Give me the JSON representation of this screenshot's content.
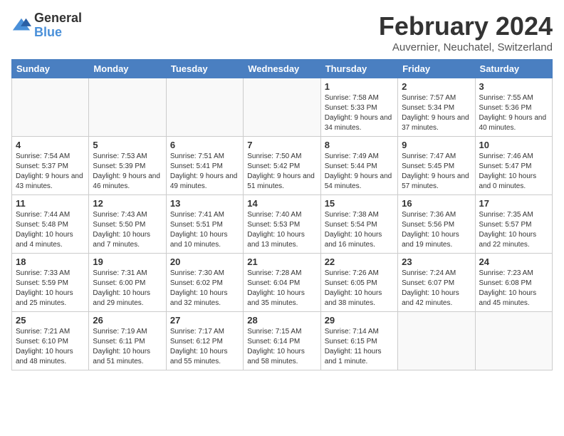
{
  "header": {
    "logo_general": "General",
    "logo_blue": "Blue",
    "title": "February 2024",
    "subtitle": "Auvernier, Neuchatel, Switzerland"
  },
  "days_of_week": [
    "Sunday",
    "Monday",
    "Tuesday",
    "Wednesday",
    "Thursday",
    "Friday",
    "Saturday"
  ],
  "weeks": [
    [
      {
        "num": "",
        "info": ""
      },
      {
        "num": "",
        "info": ""
      },
      {
        "num": "",
        "info": ""
      },
      {
        "num": "",
        "info": ""
      },
      {
        "num": "1",
        "info": "Sunrise: 7:58 AM\nSunset: 5:33 PM\nDaylight: 9 hours\nand 34 minutes."
      },
      {
        "num": "2",
        "info": "Sunrise: 7:57 AM\nSunset: 5:34 PM\nDaylight: 9 hours\nand 37 minutes."
      },
      {
        "num": "3",
        "info": "Sunrise: 7:55 AM\nSunset: 5:36 PM\nDaylight: 9 hours\nand 40 minutes."
      }
    ],
    [
      {
        "num": "4",
        "info": "Sunrise: 7:54 AM\nSunset: 5:37 PM\nDaylight: 9 hours\nand 43 minutes."
      },
      {
        "num": "5",
        "info": "Sunrise: 7:53 AM\nSunset: 5:39 PM\nDaylight: 9 hours\nand 46 minutes."
      },
      {
        "num": "6",
        "info": "Sunrise: 7:51 AM\nSunset: 5:41 PM\nDaylight: 9 hours\nand 49 minutes."
      },
      {
        "num": "7",
        "info": "Sunrise: 7:50 AM\nSunset: 5:42 PM\nDaylight: 9 hours\nand 51 minutes."
      },
      {
        "num": "8",
        "info": "Sunrise: 7:49 AM\nSunset: 5:44 PM\nDaylight: 9 hours\nand 54 minutes."
      },
      {
        "num": "9",
        "info": "Sunrise: 7:47 AM\nSunset: 5:45 PM\nDaylight: 9 hours\nand 57 minutes."
      },
      {
        "num": "10",
        "info": "Sunrise: 7:46 AM\nSunset: 5:47 PM\nDaylight: 10 hours\nand 0 minutes."
      }
    ],
    [
      {
        "num": "11",
        "info": "Sunrise: 7:44 AM\nSunset: 5:48 PM\nDaylight: 10 hours\nand 4 minutes."
      },
      {
        "num": "12",
        "info": "Sunrise: 7:43 AM\nSunset: 5:50 PM\nDaylight: 10 hours\nand 7 minutes."
      },
      {
        "num": "13",
        "info": "Sunrise: 7:41 AM\nSunset: 5:51 PM\nDaylight: 10 hours\nand 10 minutes."
      },
      {
        "num": "14",
        "info": "Sunrise: 7:40 AM\nSunset: 5:53 PM\nDaylight: 10 hours\nand 13 minutes."
      },
      {
        "num": "15",
        "info": "Sunrise: 7:38 AM\nSunset: 5:54 PM\nDaylight: 10 hours\nand 16 minutes."
      },
      {
        "num": "16",
        "info": "Sunrise: 7:36 AM\nSunset: 5:56 PM\nDaylight: 10 hours\nand 19 minutes."
      },
      {
        "num": "17",
        "info": "Sunrise: 7:35 AM\nSunset: 5:57 PM\nDaylight: 10 hours\nand 22 minutes."
      }
    ],
    [
      {
        "num": "18",
        "info": "Sunrise: 7:33 AM\nSunset: 5:59 PM\nDaylight: 10 hours\nand 25 minutes."
      },
      {
        "num": "19",
        "info": "Sunrise: 7:31 AM\nSunset: 6:00 PM\nDaylight: 10 hours\nand 29 minutes."
      },
      {
        "num": "20",
        "info": "Sunrise: 7:30 AM\nSunset: 6:02 PM\nDaylight: 10 hours\nand 32 minutes."
      },
      {
        "num": "21",
        "info": "Sunrise: 7:28 AM\nSunset: 6:04 PM\nDaylight: 10 hours\nand 35 minutes."
      },
      {
        "num": "22",
        "info": "Sunrise: 7:26 AM\nSunset: 6:05 PM\nDaylight: 10 hours\nand 38 minutes."
      },
      {
        "num": "23",
        "info": "Sunrise: 7:24 AM\nSunset: 6:07 PM\nDaylight: 10 hours\nand 42 minutes."
      },
      {
        "num": "24",
        "info": "Sunrise: 7:23 AM\nSunset: 6:08 PM\nDaylight: 10 hours\nand 45 minutes."
      }
    ],
    [
      {
        "num": "25",
        "info": "Sunrise: 7:21 AM\nSunset: 6:10 PM\nDaylight: 10 hours\nand 48 minutes."
      },
      {
        "num": "26",
        "info": "Sunrise: 7:19 AM\nSunset: 6:11 PM\nDaylight: 10 hours\nand 51 minutes."
      },
      {
        "num": "27",
        "info": "Sunrise: 7:17 AM\nSunset: 6:12 PM\nDaylight: 10 hours\nand 55 minutes."
      },
      {
        "num": "28",
        "info": "Sunrise: 7:15 AM\nSunset: 6:14 PM\nDaylight: 10 hours\nand 58 minutes."
      },
      {
        "num": "29",
        "info": "Sunrise: 7:14 AM\nSunset: 6:15 PM\nDaylight: 11 hours\nand 1 minute."
      },
      {
        "num": "",
        "info": ""
      },
      {
        "num": "",
        "info": ""
      }
    ]
  ]
}
